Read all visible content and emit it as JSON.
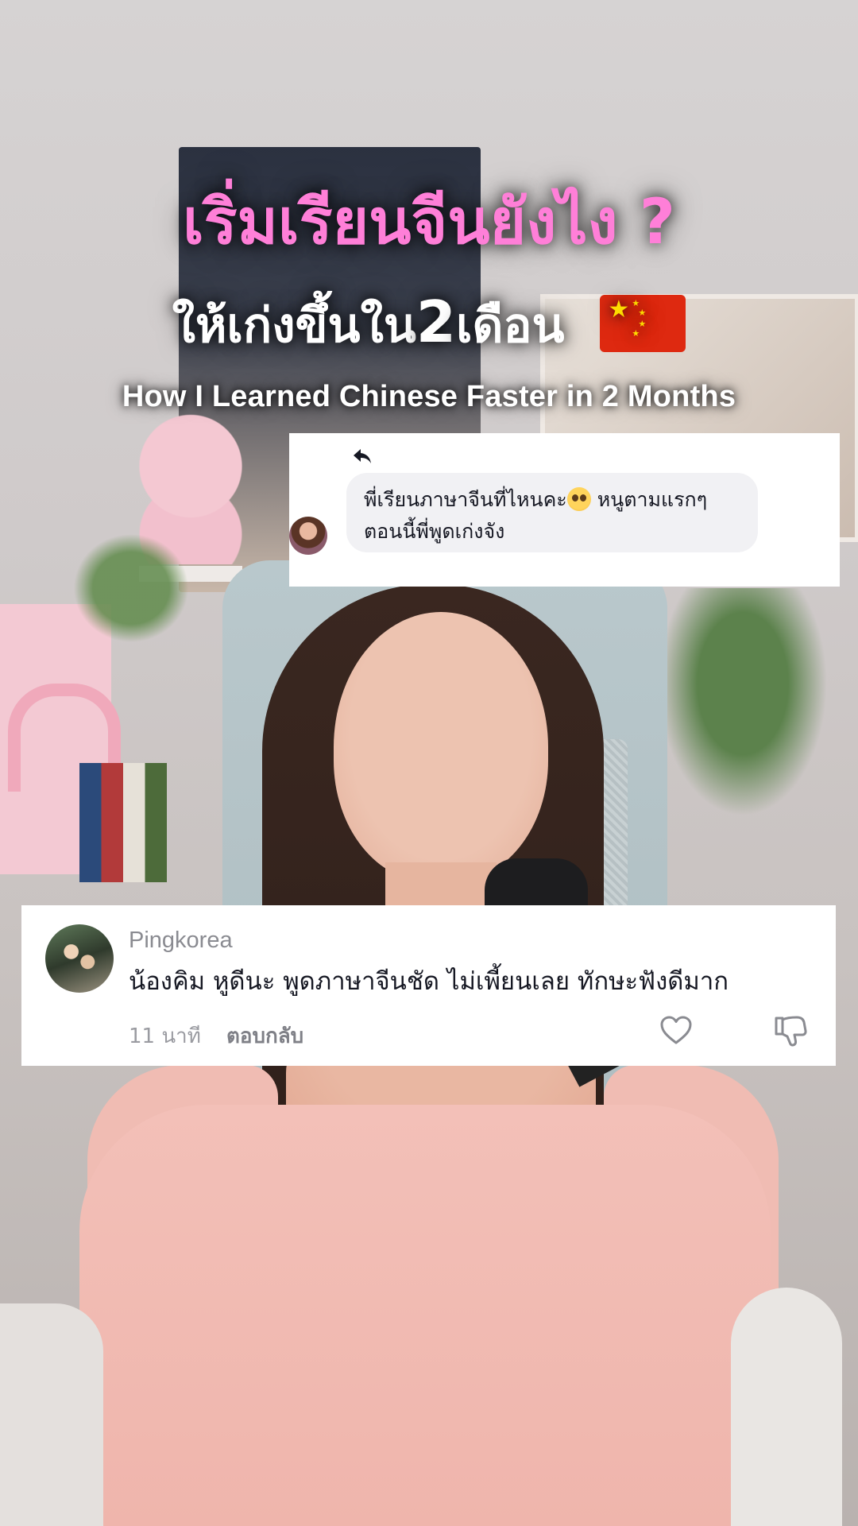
{
  "overlay": {
    "title_main": "เริ่มเรียนจีนยังไง ?",
    "title_sub_before": "ให้เก่งขึ้นใน",
    "title_sub_number": "2",
    "title_sub_after": "เดือน",
    "flag_icon": "china-flag-icon",
    "title_en": "How I Learned Chinese Faster in 2 Months",
    "title_main_color": "#ff7fd8"
  },
  "reply_to_comment": {
    "icon": "reply-arrow-icon",
    "text_part1": "พี่เรียนภาษาจีนที่ไหนคะ",
    "emoji": "pleading-face-emoji",
    "text_part2": " หนูตามแรกๆ",
    "text_line2": "ตอนนี้พี่พูดเก่งจัง"
  },
  "comment": {
    "username": "Pingkorea",
    "text": "น้องคิม หูดีนะ พูดภาษาจีนชัด ไม่เพี้ยนเลย ทักษะฟังดีมาก",
    "time": "11 นาที",
    "reply_label": "ตอบกลับ",
    "like_icon": "heart-icon",
    "dislike_icon": "thumbs-down-icon"
  }
}
